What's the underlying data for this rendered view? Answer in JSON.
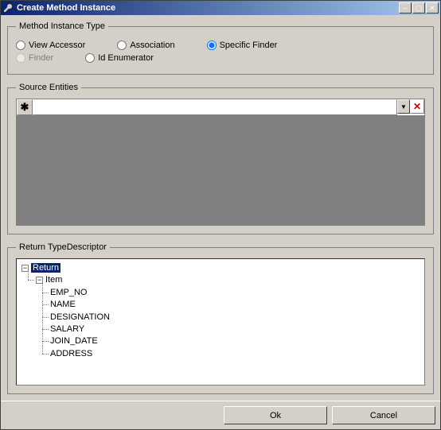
{
  "window": {
    "title": "Create Method Instance"
  },
  "methodType": {
    "legend": "Method Instance Type",
    "options": {
      "viewAccessor": {
        "label": "View Accessor",
        "checked": false,
        "enabled": true
      },
      "association": {
        "label": "Association",
        "checked": false,
        "enabled": true
      },
      "specificFinder": {
        "label": "Specific Finder",
        "checked": true,
        "enabled": true
      },
      "finder": {
        "label": "Finder",
        "checked": false,
        "enabled": false
      },
      "idEnumerator": {
        "label": "Id Enumerator",
        "checked": false,
        "enabled": true
      }
    }
  },
  "sourceEntities": {
    "legend": "Source Entities",
    "rowMarker": "✱",
    "deleteIcon": "✕",
    "dropdownIcon": "▼"
  },
  "returnType": {
    "legend": "Return TypeDescriptor",
    "root": {
      "label": "Return",
      "expanded": true,
      "selected": true,
      "children": [
        {
          "label": "Item",
          "expanded": true,
          "children": [
            {
              "label": "EMP_NO"
            },
            {
              "label": "NAME"
            },
            {
              "label": "DESIGNATION"
            },
            {
              "label": "SALARY"
            },
            {
              "label": "JOIN_DATE"
            },
            {
              "label": "ADDRESS"
            }
          ]
        }
      ]
    }
  },
  "buttons": {
    "ok": "Ok",
    "cancel": "Cancel"
  },
  "titleButtons": {
    "minimize": "–",
    "maximize": "▢",
    "close": "✕"
  }
}
